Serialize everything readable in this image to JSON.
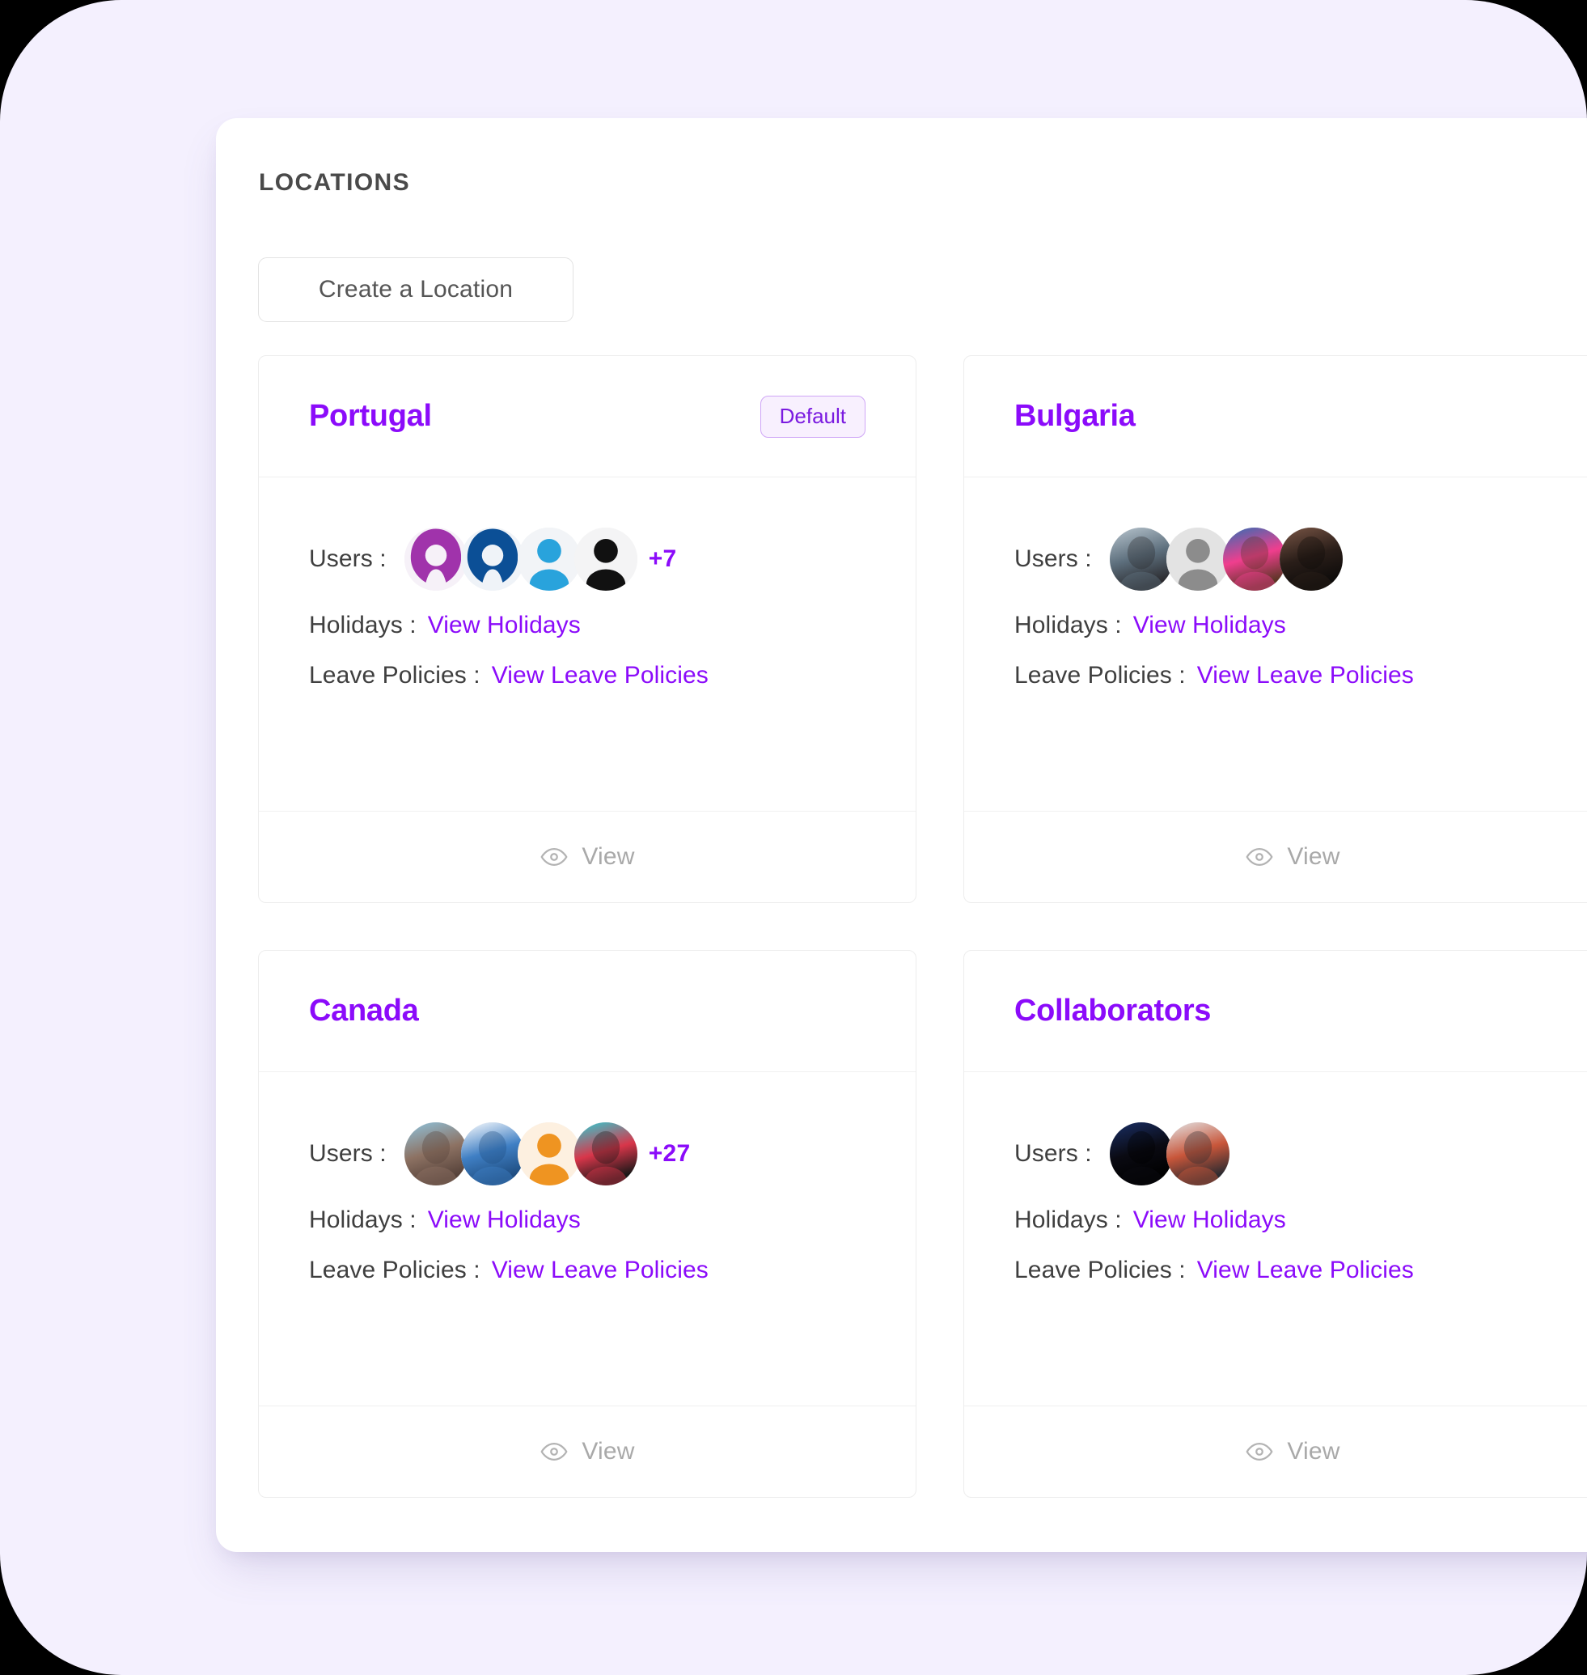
{
  "page": {
    "background_color": "#f4f0fe",
    "panel_color": "#ffffff",
    "accent_color": "#8b0bfa"
  },
  "header": {
    "section_title": "LOCATIONS"
  },
  "toolbar": {
    "create_location_label": "Create a Location"
  },
  "labels": {
    "users": "Users :",
    "holidays": "Holidays :",
    "leave_policies": "Leave Policies :",
    "view": "View",
    "view_holidays": "View Holidays",
    "view_leave_policies": "View Leave Policies",
    "default_badge": "Default"
  },
  "locations": [
    {
      "name": "Portugal",
      "is_default": true,
      "badge": "Default",
      "users_label": "Users :",
      "holidays_label": "Holidays :",
      "holidays_link": "View Holidays",
      "leave_policies_label": "Leave Policies :",
      "leave_policies_link": "View Leave Policies",
      "more_users": "+7",
      "view_label": "View",
      "avatars": [
        {
          "type": "glyph-inverted",
          "color": "#a033ab",
          "bg": "#f6f1f8"
        },
        {
          "type": "glyph-inverted",
          "color": "#0b4f96",
          "bg": "#eff3f8"
        },
        {
          "type": "glyph",
          "color": "#29a3dc",
          "bg": "#f2f4f7"
        },
        {
          "type": "glyph",
          "color": "#111111",
          "bg": "#f4f4f5"
        }
      ]
    },
    {
      "name": "Bulgaria",
      "is_default": false,
      "badge": "",
      "users_label": "Users :",
      "holidays_label": "Holidays :",
      "holidays_link": "View Holidays",
      "leave_policies_label": "Leave Policies :",
      "leave_policies_link": "View Leave Policies",
      "more_users": "",
      "view_label": "View",
      "avatars": [
        {
          "type": "photo",
          "c1": "#b9c6cf",
          "c2": "#5d6f7d",
          "c3": "#2b2b2f"
        },
        {
          "type": "glyph",
          "color": "#8c8c8c",
          "bg": "#e3e3e3"
        },
        {
          "type": "photo",
          "c1": "#2f6fb5",
          "c2": "#f03e8e",
          "c3": "#5a3524"
        },
        {
          "type": "photo",
          "c1": "#7a5646",
          "c2": "#2a1e19",
          "c3": "#0d0b0a"
        }
      ]
    },
    {
      "name": "Canada",
      "is_default": false,
      "badge": "",
      "users_label": "Users :",
      "holidays_label": "Holidays :",
      "holidays_link": "View Holidays",
      "leave_policies_label": "Leave Policies :",
      "leave_policies_link": "View Leave Policies",
      "more_users": "+27",
      "view_label": "View",
      "avatars": [
        {
          "type": "photo",
          "c1": "#8fc3dd",
          "c2": "#8d7263",
          "c3": "#56423a"
        },
        {
          "type": "photo",
          "c1": "#ffffff",
          "c2": "#3f7fc4",
          "c3": "#1f4d80"
        },
        {
          "type": "glyph",
          "color": "#ef9421",
          "bg": "#fdf0e0"
        },
        {
          "type": "photo",
          "c1": "#2bd0d6",
          "c2": "#d8364a",
          "c3": "#171717"
        }
      ]
    },
    {
      "name": "Collaborators",
      "is_default": false,
      "badge": "",
      "users_label": "Users :",
      "holidays_label": "Holidays :",
      "holidays_link": "View Holidays",
      "leave_policies_label": "Leave Policies :",
      "leave_policies_link": "View Leave Policies",
      "more_users": "",
      "view_label": "View",
      "avatars": [
        {
          "type": "photo",
          "c1": "#1a2f66",
          "c2": "#0a0a12",
          "c3": "#000000"
        },
        {
          "type": "photo",
          "c1": "#e3e6e8",
          "c2": "#c8563a",
          "c3": "#2a2a30"
        }
      ]
    }
  ],
  "icons": {
    "eye": "eye-icon",
    "person": "person-icon"
  }
}
